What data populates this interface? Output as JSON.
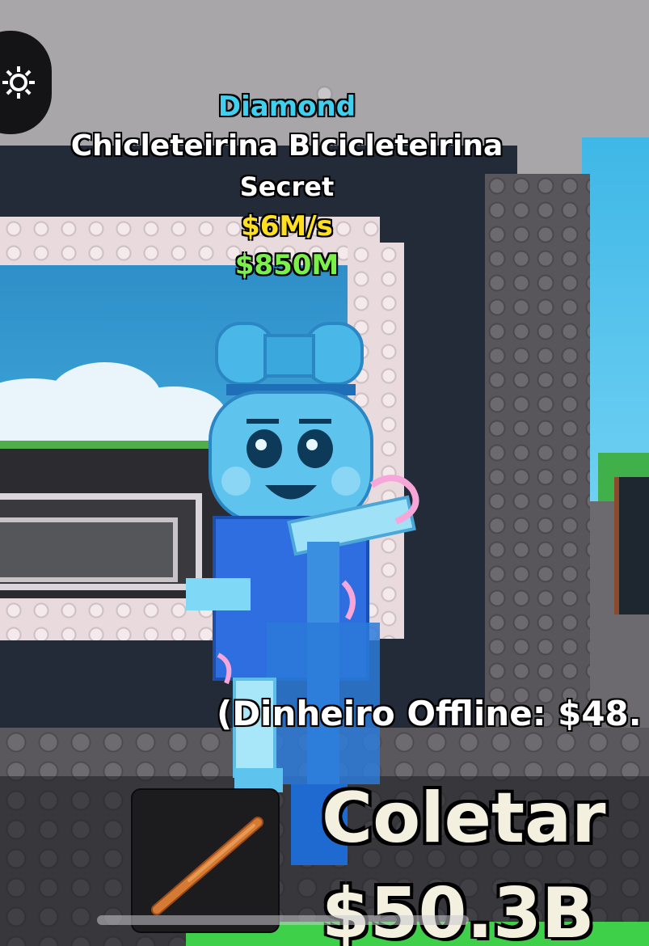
{
  "overhead": {
    "rarity": "Diamond",
    "name": "Chicleteirina Bicicleteirina",
    "tier": "Secret",
    "rate": "$6M/s",
    "price": "$850M"
  },
  "offline_text": "(Dinheiro Offline: $48.",
  "collect": {
    "label": "Coletar",
    "amount": "$50.3B"
  },
  "hud": {
    "settings_icon": "gear-icon",
    "hotbar_item_icon": "baseball-bat-icon"
  },
  "colors": {
    "rarity": "#3fd0f0",
    "rate": "#ffe020",
    "price": "#7cf04a"
  }
}
